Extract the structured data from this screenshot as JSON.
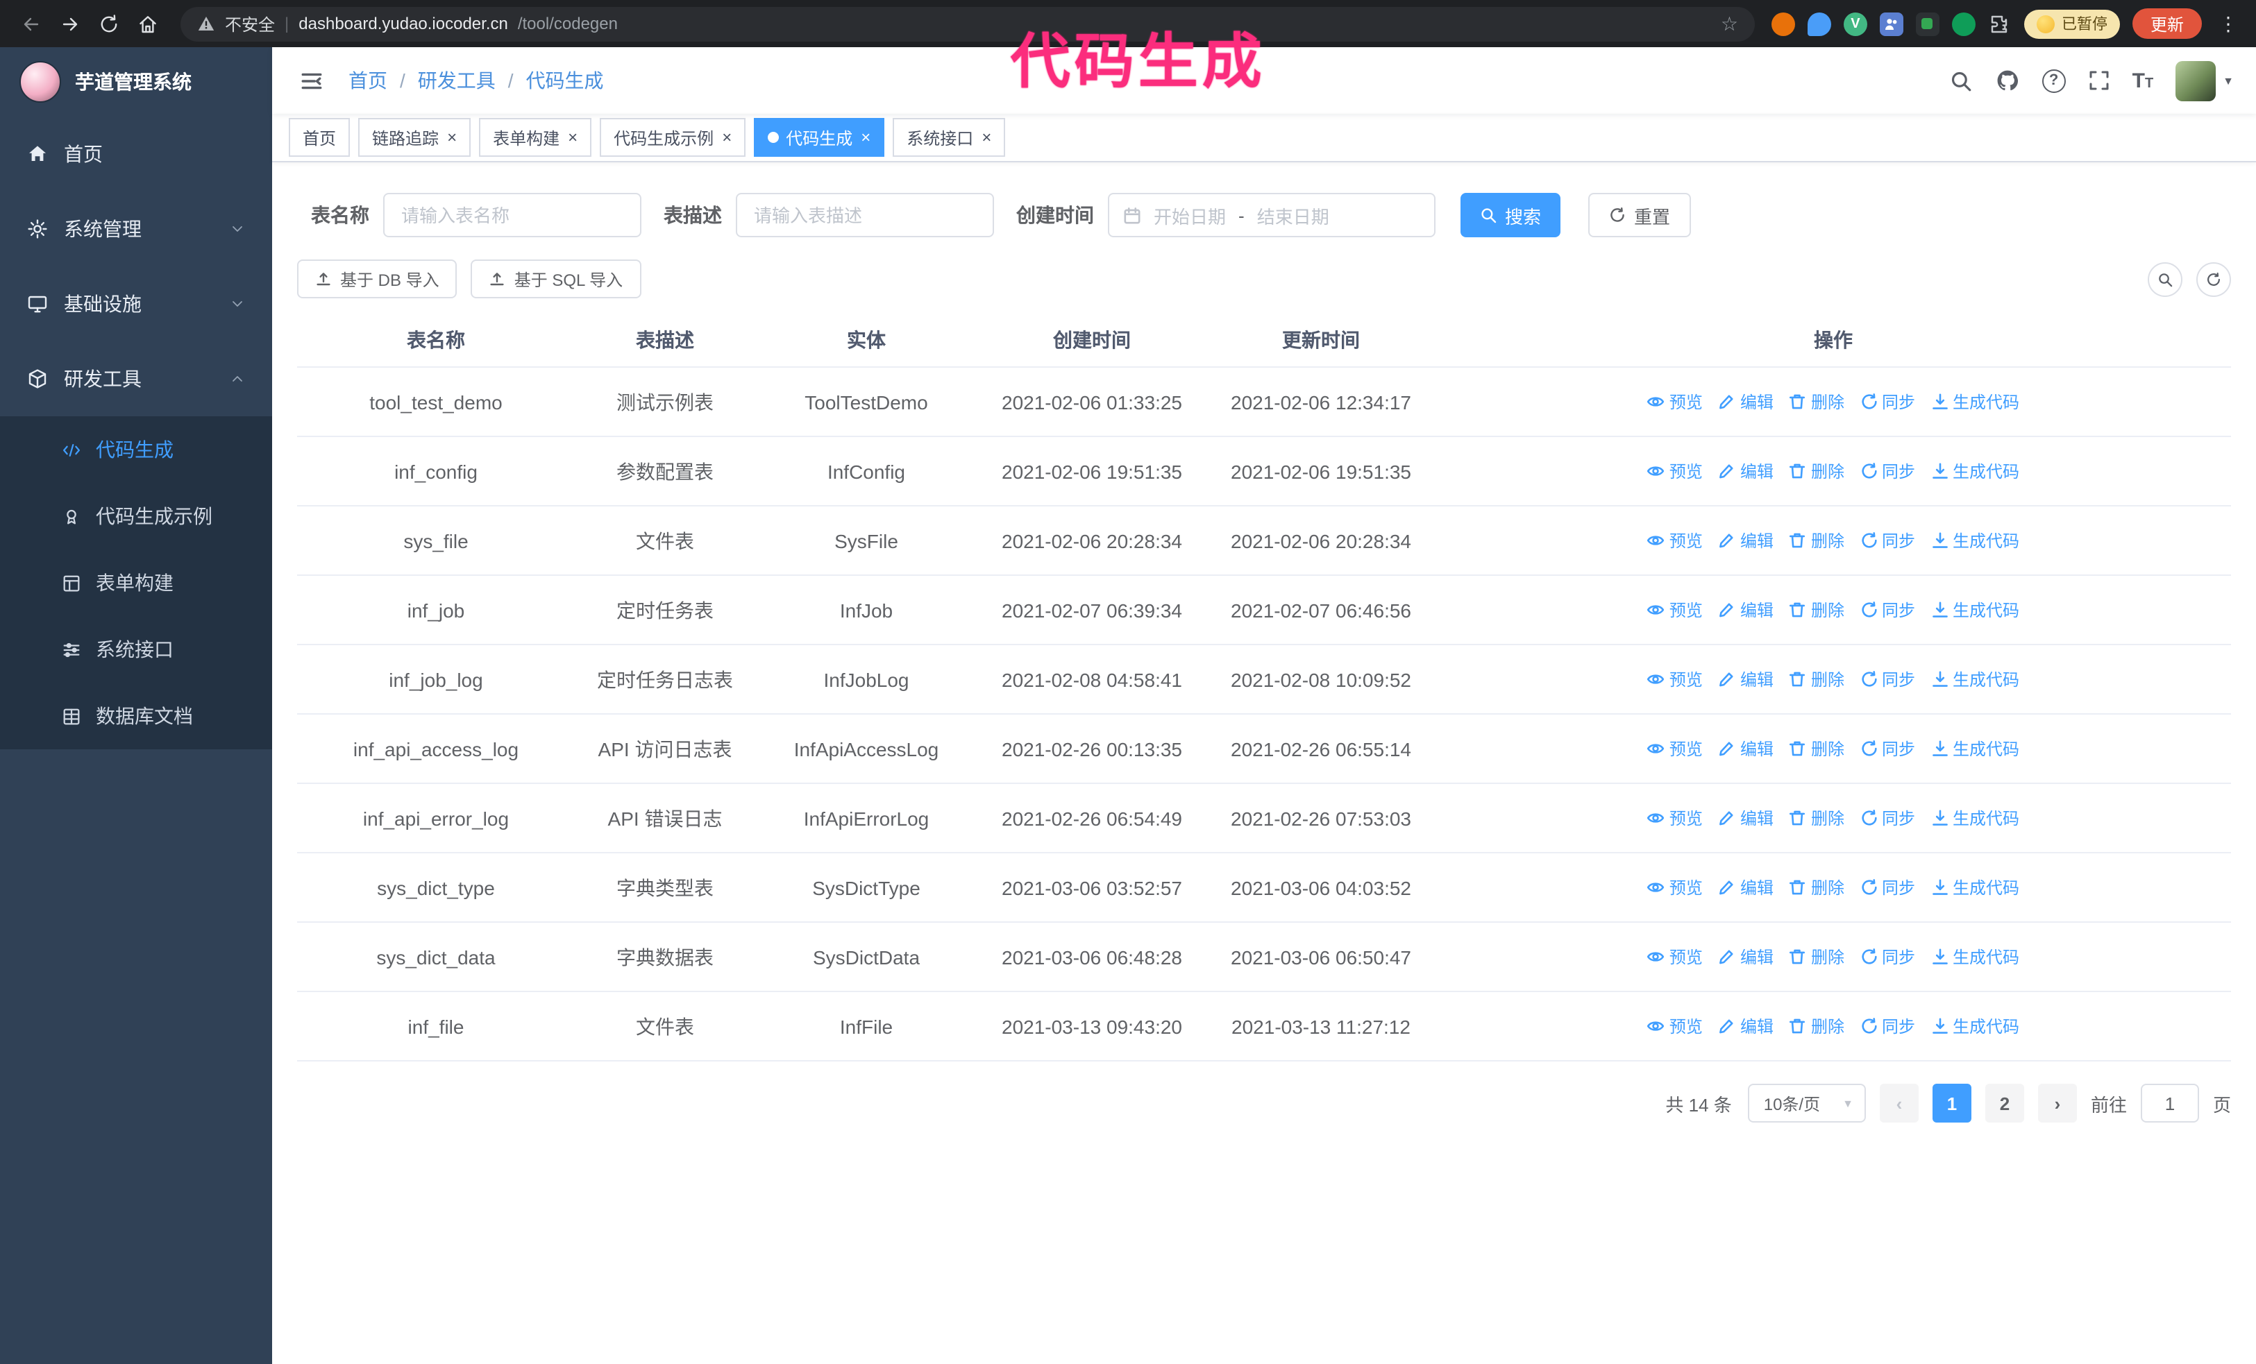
{
  "colors": {
    "accent": "#409eff",
    "annotation": "#fb2d7d",
    "sidebar_bg": "#304156",
    "submenu_bg": "#233243"
  },
  "annotation": {
    "text": "代码生成"
  },
  "glyphs": {
    "close": "×",
    "star": "☆",
    "caret": "▼",
    "kebab": "⋮",
    "prev": "‹",
    "next": "›",
    "question": "?",
    "t_big": "T",
    "t_small": "T"
  },
  "browser": {
    "security_label": "不安全",
    "url_divider": "|",
    "url_host": "dashboard.yudao.iocoder.cn",
    "url_path": "/tool/codegen",
    "paused_badge": "已暂停",
    "update_button": "更新",
    "vue_ext_letter": "V"
  },
  "sidebar": {
    "title": "芋道管理系统",
    "items": [
      {
        "label": "首页"
      },
      {
        "label": "系统管理"
      },
      {
        "label": "基础设施"
      },
      {
        "label": "研发工具"
      }
    ],
    "submenu": [
      {
        "label": "代码生成"
      },
      {
        "label": "代码生成示例"
      },
      {
        "label": "表单构建"
      },
      {
        "label": "系统接口"
      },
      {
        "label": "数据库文档"
      }
    ]
  },
  "breadcrumb": {
    "items": [
      "首页",
      "研发工具",
      "代码生成"
    ],
    "separator": "/"
  },
  "tabs": [
    {
      "label": "首页"
    },
    {
      "label": "链路追踪"
    },
    {
      "label": "表单构建"
    },
    {
      "label": "代码生成示例"
    },
    {
      "label": "代码生成"
    },
    {
      "label": "系统接口"
    }
  ],
  "filters": {
    "table_name_label": "表名称",
    "table_name_placeholder": "请输入表名称",
    "table_desc_label": "表描述",
    "table_desc_placeholder": "请输入表描述",
    "create_time_label": "创建时间",
    "date_start_placeholder": "开始日期",
    "date_separator": "-",
    "date_end_placeholder": "结束日期",
    "search_button": "搜索",
    "reset_button": "重置"
  },
  "toolbar": {
    "import_db": "基于 DB 导入",
    "import_sql": "基于 SQL 导入"
  },
  "table": {
    "columns": [
      "表名称",
      "表描述",
      "实体",
      "创建时间",
      "更新时间",
      "操作"
    ],
    "actions": [
      "预览",
      "编辑",
      "删除",
      "同步",
      "生成代码"
    ],
    "rows": [
      {
        "name": "tool_test_demo",
        "desc": "测试示例表",
        "entity": "ToolTestDemo",
        "created": "2021-02-06 01:33:25",
        "updated": "2021-02-06 12:34:17"
      },
      {
        "name": "inf_config",
        "desc": "参数配置表",
        "entity": "InfConfig",
        "created": "2021-02-06 19:51:35",
        "updated": "2021-02-06 19:51:35"
      },
      {
        "name": "sys_file",
        "desc": "文件表",
        "entity": "SysFile",
        "created": "2021-02-06 20:28:34",
        "updated": "2021-02-06 20:28:34"
      },
      {
        "name": "inf_job",
        "desc": "定时任务表",
        "entity": "InfJob",
        "created": "2021-02-07 06:39:34",
        "updated": "2021-02-07 06:46:56"
      },
      {
        "name": "inf_job_log",
        "desc": "定时任务日志表",
        "entity": "InfJobLog",
        "created": "2021-02-08 04:58:41",
        "updated": "2021-02-08 10:09:52"
      },
      {
        "name": "inf_api_access_log",
        "desc": "API 访问日志表",
        "entity": "InfApiAccessLog",
        "created": "2021-02-26 00:13:35",
        "updated": "2021-02-26 06:55:14"
      },
      {
        "name": "inf_api_error_log",
        "desc": "API 错误日志",
        "entity": "InfApiErrorLog",
        "created": "2021-02-26 06:54:49",
        "updated": "2021-02-26 07:53:03"
      },
      {
        "name": "sys_dict_type",
        "desc": "字典类型表",
        "entity": "SysDictType",
        "created": "2021-03-06 03:52:57",
        "updated": "2021-03-06 04:03:52"
      },
      {
        "name": "sys_dict_data",
        "desc": "字典数据表",
        "entity": "SysDictData",
        "created": "2021-03-06 06:48:28",
        "updated": "2021-03-06 06:50:47"
      },
      {
        "name": "inf_file",
        "desc": "文件表",
        "entity": "InfFile",
        "created": "2021-03-13 09:43:20",
        "updated": "2021-03-13 11:27:12"
      }
    ]
  },
  "pagination": {
    "total": "共 14 条",
    "page_size": "10条/页",
    "pages": [
      "1",
      "2"
    ],
    "goto_label": "前往",
    "goto_value": "1",
    "goto_suffix": "页"
  }
}
